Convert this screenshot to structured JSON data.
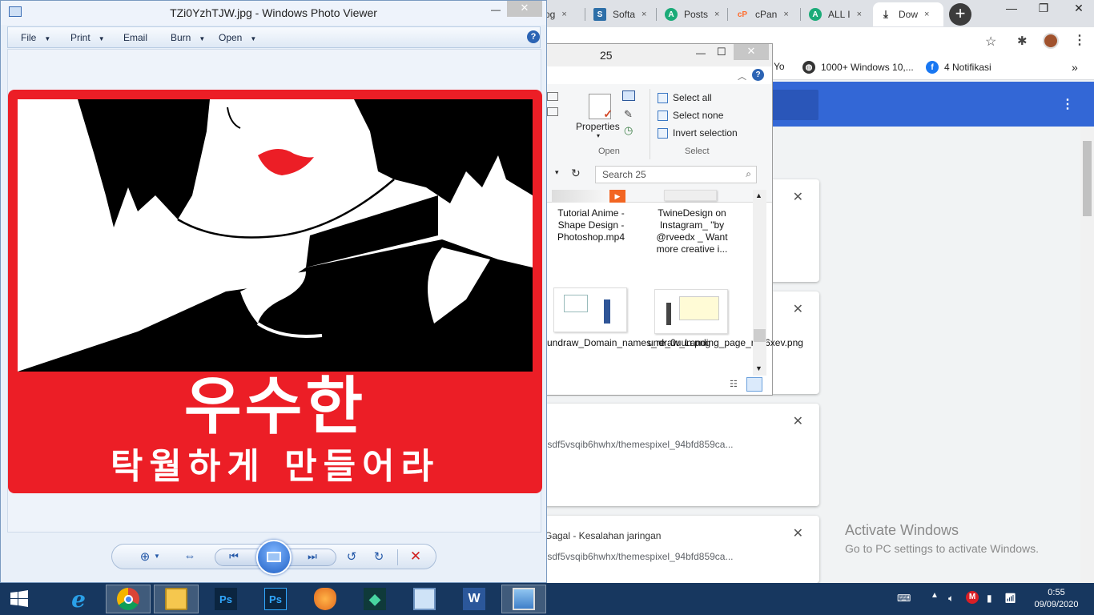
{
  "browser": {
    "tabs": [
      {
        "label": "og",
        "favicon": "tab-favicon"
      },
      {
        "label": "Softa",
        "favicon": "softaculous-icon"
      },
      {
        "label": "Posts",
        "favicon": "a-circle-icon"
      },
      {
        "label": "cPan",
        "favicon": "cpanel-icon"
      },
      {
        "label": "ALL I",
        "favicon": "a-circle-icon"
      },
      {
        "label": "Dow",
        "favicon": "download-icon"
      }
    ],
    "close_glyph": "×",
    "new_tab_glyph": "+",
    "bookmarks": [
      {
        "label": "Yo"
      },
      {
        "label": "1000+ Windows 10,..."
      },
      {
        "label": "4 Notifikasi"
      }
    ],
    "bookmarks_more": "»",
    "accent": "#3367d6"
  },
  "downloads": {
    "cards": [
      {
        "status": "",
        "url": ""
      },
      {
        "status": "",
        "url": ""
      },
      {
        "status": "",
        "url": "/sdf5vsqib6hwhx/themespixel_94bfd859ca..."
      },
      {
        "status": "Gagal - Kesalahan jaringan",
        "url": "/sdf5vsqib6hwhx/themespixel_94bfd859ca..."
      }
    ],
    "close_glyph": "✕"
  },
  "activation": {
    "title": "Activate Windows",
    "subtitle": "Go to PC settings to activate Windows."
  },
  "explorer": {
    "title": "25",
    "ribbon": {
      "properties_label": "Properties",
      "open_group": "Open",
      "select_group": "Select",
      "select_all": "Select all",
      "select_none": "Select none",
      "invert_selection": "Invert selection"
    },
    "search_placeholder": "Search 25",
    "files": [
      {
        "name": "Tutorial Anime - Shape Design - Photoshop.mp4"
      },
      {
        "name": "TwineDesign on Instagram_ \"by @rveedx _ Want more creative i..."
      },
      {
        "name": "undraw_Domain_names_re_0uun.png"
      },
      {
        "name": "undraw_Landing_page_re_6xev.png"
      }
    ]
  },
  "photo_viewer": {
    "title": "TZi0YzhTJW.jpg - Windows Photo Viewer",
    "menu": [
      {
        "label": "File"
      },
      {
        "label": "Print"
      },
      {
        "label": "Email"
      },
      {
        "label": "Burn"
      },
      {
        "label": "Open"
      }
    ],
    "help_glyph": "?",
    "image_text_line1": "우수한",
    "image_text_line2": "탁월하게 만들어라",
    "image_bg_color": "#ec1e26"
  },
  "taskbar": {
    "time": "0:55",
    "date": "09/09/2020",
    "apps": [
      {
        "name": "internet-explorer-icon"
      },
      {
        "name": "chrome-icon"
      },
      {
        "name": "file-explorer-icon"
      },
      {
        "name": "photoshop-icon"
      },
      {
        "name": "photoshop-icon"
      },
      {
        "name": "fl-studio-icon"
      },
      {
        "name": "filmora-icon"
      },
      {
        "name": "remote-desktop-icon"
      },
      {
        "name": "word-icon"
      },
      {
        "name": "photo-viewer-icon"
      }
    ],
    "ps_label": "Ps",
    "word_label": "W"
  }
}
